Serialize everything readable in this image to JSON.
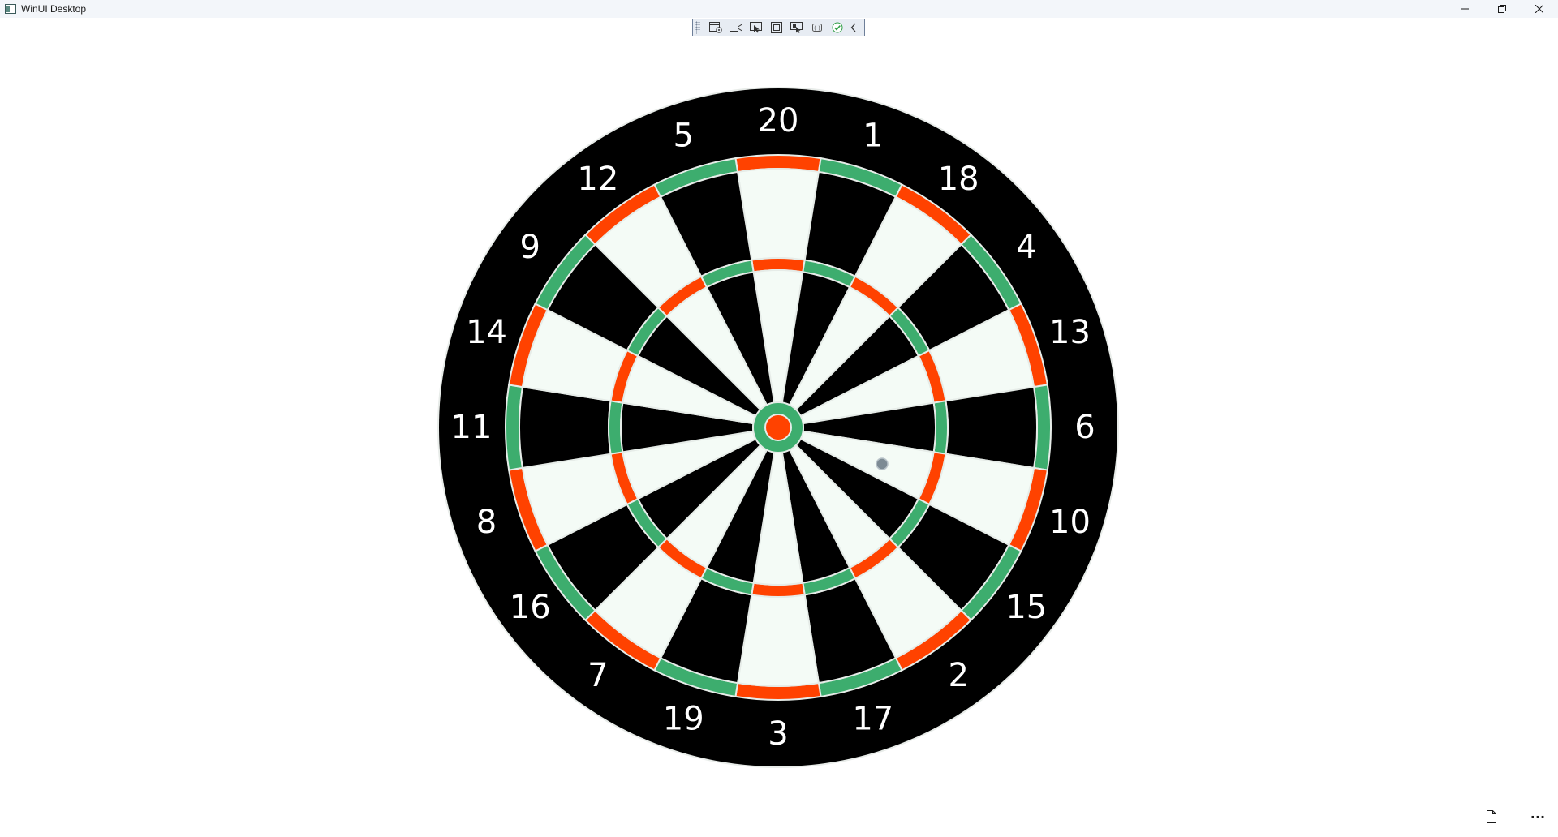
{
  "window": {
    "title": "WinUI Desktop"
  },
  "icons": {
    "app": "app-window-icon",
    "minimize": "minimize-icon",
    "restore": "restore-icon",
    "close": "close-icon",
    "document": "document-icon",
    "more": "more-ellipsis-icon"
  },
  "toolbar": {
    "items": [
      "app-overview-icon",
      "record-icon",
      "select-element-icon",
      "layout-adorners-icon",
      "display-layout-icon",
      "track-focus-icon",
      "binding-check-icon",
      "collapse-chevron-icon"
    ]
  },
  "dartboard": {
    "numbers": [
      "20",
      "1",
      "18",
      "4",
      "13",
      "6",
      "10",
      "15",
      "2",
      "17",
      "3",
      "19",
      "7",
      "16",
      "8",
      "11",
      "14",
      "9",
      "12",
      "5"
    ],
    "colors": {
      "outer_ring": "#000000",
      "single_light": "#f4fbf6",
      "single_dark": "#000000",
      "red": "#ff4200",
      "green": "#3dad6e",
      "number_text": "#ffffff",
      "marker": "#7d8b94"
    }
  },
  "more_button": {
    "label": "···"
  }
}
